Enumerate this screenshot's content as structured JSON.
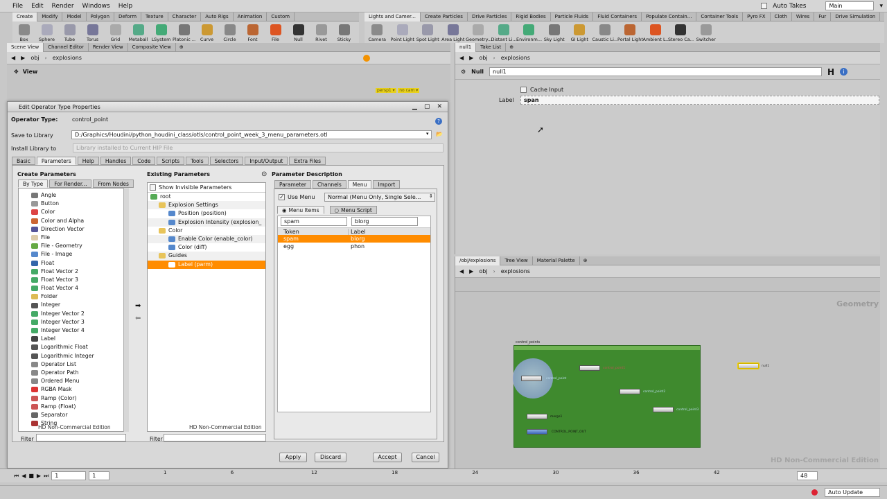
{
  "menubar": {
    "items": [
      "File",
      "Edit",
      "Render",
      "Windows",
      "Help"
    ],
    "auto_takes": "Auto Takes",
    "desktop": "Main"
  },
  "shelf_left": {
    "tabs": [
      "Create",
      "Modify",
      "Model",
      "Polygon",
      "Deform",
      "Texture",
      "Character",
      "Auto Rigs",
      "Animation",
      "Custom"
    ],
    "tools": [
      "Box",
      "Sphere",
      "Tube",
      "Torus",
      "Grid",
      "Metaball",
      "LSystem",
      "Platonic ...",
      "Curve",
      "Circle",
      "Font",
      "File",
      "Null",
      "Rivet",
      "Sticky"
    ]
  },
  "shelf_right": {
    "tabs": [
      "Lights and Camer...",
      "Create Particles",
      "Drive Particles",
      "Rigid Bodies",
      "Particle Fluids",
      "Fluid Containers",
      "Populate Contain...",
      "Container Tools",
      "Pyro FX",
      "Cloth",
      "Wires",
      "Fur",
      "Drive Simulation"
    ],
    "tools": [
      "Camera",
      "Point Light",
      "Spot Light",
      "Area Light",
      "Geometry...",
      "Distant Li...",
      "Environm...",
      "Sky Light",
      "GI Light",
      "Caustic Li...",
      "Portal Light",
      "Ambient L...",
      "Stereo Ca...",
      "Switcher"
    ]
  },
  "scene_pane": {
    "tabs": [
      "Scene View",
      "Channel Editor",
      "Render View",
      "Composite View"
    ],
    "path_obj": "obj",
    "path_node": "explosions",
    "view_label": "View",
    "persp": "persp1 ▾",
    "cam": "no cam ▾"
  },
  "params_pane": {
    "tabs": [
      "null1",
      "Take List"
    ],
    "path_obj": "obj",
    "path_node": "explosions",
    "node_type": "Null",
    "node_name": "null1",
    "cache_input": "Cache Input",
    "label_caption": "Label",
    "label_value": "span"
  },
  "network_pane": {
    "tabs": [
      "/obj/explosions",
      "Tree View",
      "Material Palette"
    ],
    "path_obj": "obj",
    "path_node": "explosions",
    "context": "Geometry",
    "watermark": "HD Non-Commercial Edition",
    "subnet_label": "control_points",
    "nodes": [
      "control_point",
      "control_point1",
      "control_point2",
      "control_point3",
      "merge1",
      "CONTROL_POINT_OUT",
      "null1"
    ]
  },
  "dialog": {
    "title": "Edit Operator Type Properties",
    "operator_type_label": "Operator Type:",
    "operator_type_value": "control_point",
    "save_label": "Save to Library",
    "save_path": "D:/Graphics/Houdini/python_houdini_class/otls/control_point_week_3_menu_parameters.otl",
    "install_label": "Install Library to",
    "install_value": "Library installed to Current HIP File",
    "tabs": [
      "Basic",
      "Parameters",
      "Help",
      "Handles",
      "Code",
      "Scripts",
      "Tools",
      "Selectors",
      "Input/Output",
      "Extra Files"
    ],
    "create_params": {
      "header": "Create Parameters",
      "tabs": [
        "By Type",
        "For Render...",
        "From Nodes"
      ],
      "items": [
        "Angle",
        "Button",
        "Color",
        "Color and Alpha",
        "Direction Vector",
        "File",
        "File - Geometry",
        "File - Image",
        "Float",
        "Float Vector 2",
        "Float Vector 3",
        "Float Vector 4",
        "Folder",
        "Integer",
        "Integer Vector 2",
        "Integer Vector 3",
        "Integer Vector 4",
        "Label",
        "Logarithmic Float",
        "Logarithmic Integer",
        "Operator List",
        "Operator Path",
        "Ordered Menu",
        "RGBA Mask",
        "Ramp (Color)",
        "Ramp (Float)",
        "Separator",
        "String"
      ],
      "watermark": "HD Non-Commercial Edition",
      "filter": "Filter"
    },
    "existing_params": {
      "header": "Existing Parameters",
      "show_invisible": "Show Invisible Parameters",
      "tree": [
        "root",
        "Explosion Settings",
        "Position (position)",
        "Explosion Intensity (explosion_",
        "Color",
        "Enable Color (enable_color)",
        "Color (diff)",
        "Guides",
        "Label (parm)"
      ],
      "watermark": "HD Non-Commercial Edition",
      "filter": "Filter"
    },
    "param_desc": {
      "header": "Parameter Description",
      "tabs": [
        "Parameter",
        "Channels",
        "Menu",
        "Import"
      ],
      "use_menu": "Use Menu",
      "menu_type": "Normal (Menu Only, Single Sele...",
      "radio_items": "Menu Items",
      "radio_script": "Menu Script",
      "edit_token": "spam",
      "edit_label": "blorg",
      "col_token": "Token",
      "col_label": "Label",
      "rows": [
        {
          "token": "spam",
          "label": "blorg"
        },
        {
          "token": "egg",
          "label": "phon"
        }
      ]
    },
    "buttons": {
      "apply": "Apply",
      "discard": "Discard",
      "accept": "Accept",
      "cancel": "Cancel"
    }
  },
  "timeline": {
    "frame": "1",
    "start": "1",
    "end_field": "48",
    "ticks": [
      "1",
      "6",
      "12",
      "18",
      "24",
      "30",
      "36",
      "42"
    ]
  },
  "status": {
    "auto_update": "Auto Update"
  },
  "colors": {
    "selection": "#ff8c00",
    "network_bg": "#4f8a3c",
    "subnet_bg": "#3f8a2e"
  }
}
